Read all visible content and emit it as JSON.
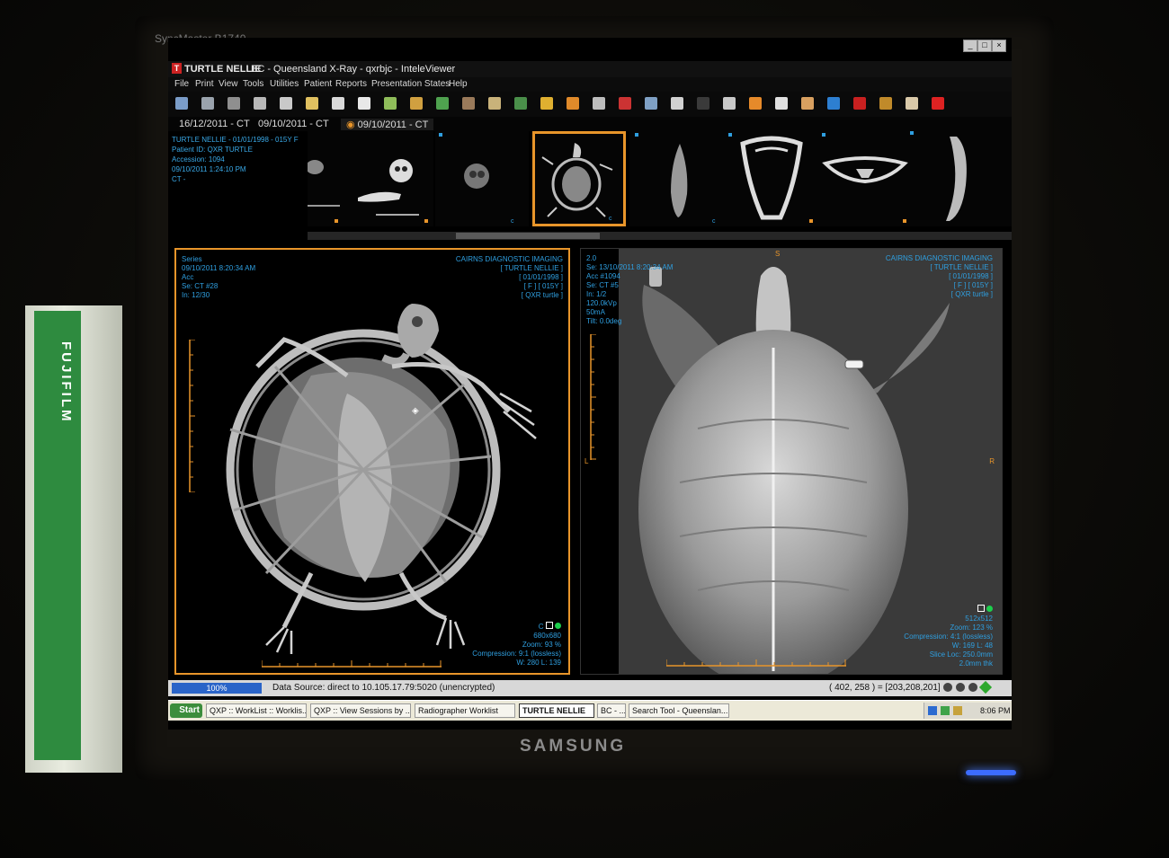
{
  "monitor": {
    "model": "SyncMaster B1740",
    "brand": "SAMSUNG"
  },
  "box_label": "FUJIFILM",
  "window": {
    "logo": "TURTLE NELLIE",
    "title": "BC - Queensland X-Ray - qxrbjc - InteleViewer",
    "controls": [
      "_",
      "□",
      "×"
    ]
  },
  "menu": [
    "File",
    "Print",
    "View",
    "Tools",
    "Utilities",
    "Patient",
    "Reports",
    "Presentation States",
    "Help"
  ],
  "toolbar_colors": [
    "#7a9cc8",
    "#9aa3ad",
    "#8f8f8f",
    "#b8b8b8",
    "#c9c9c9",
    "#e0c060",
    "#d9d9d9",
    "#e8e8e8",
    "#8fbd5a",
    "#d0a040",
    "#4fa24f",
    "#9a7a5a",
    "#c9b27a",
    "#4a8f4a",
    "#e0b030",
    "#e08a2a",
    "#bdbdbd",
    "#c33",
    "#7fa0c4",
    "#d0d0d0",
    "#3a3a3a",
    "#c8c8c8",
    "#e68a2a",
    "#e0e0e0",
    "#d8a060",
    "#2d7fd1",
    "#c82020",
    "#c08a2a",
    "#d9c9a9",
    "#d22"
  ],
  "tabs": [
    "16/12/2011 - CT",
    "09/10/2011 - CT",
    "09/10/2011 - CT"
  ],
  "patient_info": [
    "TURTLE NELLIE - 01/01/1998 - 015Y F",
    "Patient ID: QXR TURTLE",
    "Accession: 1094",
    "09/10/2011 1:24:10 PM",
    "CT -"
  ],
  "left_viewport": {
    "top_left": [
      "Series",
      "09/10/2011 8:20:34 AM",
      "Acc",
      "Se: CT #28",
      "In: 12/30"
    ],
    "top_right": [
      "CAIRNS DIAGNOSTIC IMAGING",
      "[ TURTLE NELLIE ]",
      "[ 01/01/1998 ]",
      "[ F ] [ 015Y ]",
      "[ QXR turtle ]"
    ],
    "bottom_right": [
      "C",
      "680x680",
      "Zoom: 93 %",
      "Compression: 9:1 (lossless)",
      "W: 280 L: 139"
    ]
  },
  "right_viewport": {
    "top_left": [
      "2.0",
      "Se: 13/10/2011 8:20:34 AM",
      "Acc #1094",
      "Se: CT #5",
      "In: 1/2",
      "120.0kVp",
      "50mA",
      "Tilt: 0.0deg"
    ],
    "top_right": [
      "CAIRNS DIAGNOSTIC IMAGING",
      "[ TURTLE NELLIE ]",
      "[ 01/01/1998 ]",
      "[ F ] [ 015Y ]",
      "[ QXR turtle ]"
    ],
    "bottom_right": [
      "512x512",
      "Zoom: 123 %",
      "Compression: 4:1 (lossless)",
      "W: 169 L: 48",
      "Slice Loc: 250.0mm",
      "2.0mm thk"
    ],
    "orient": {
      "top": "S",
      "left": "L",
      "right": "R"
    }
  },
  "status": {
    "progress": "100%",
    "source": "Data Source: direct to 10.105.17.79:5020 (unencrypted)",
    "coords": "( 402, 258 ) = [203,208,201]"
  },
  "taskbar": {
    "start": "Start",
    "tasks": [
      "QXP :: WorkList :: Worklis...",
      "QXP :: View Sessions by ...",
      "Radiographer Worklist",
      "TURTLE NELLIE",
      "BC - ...",
      "Search Tool - Queenslan..."
    ],
    "clock": "8:06 PM"
  }
}
